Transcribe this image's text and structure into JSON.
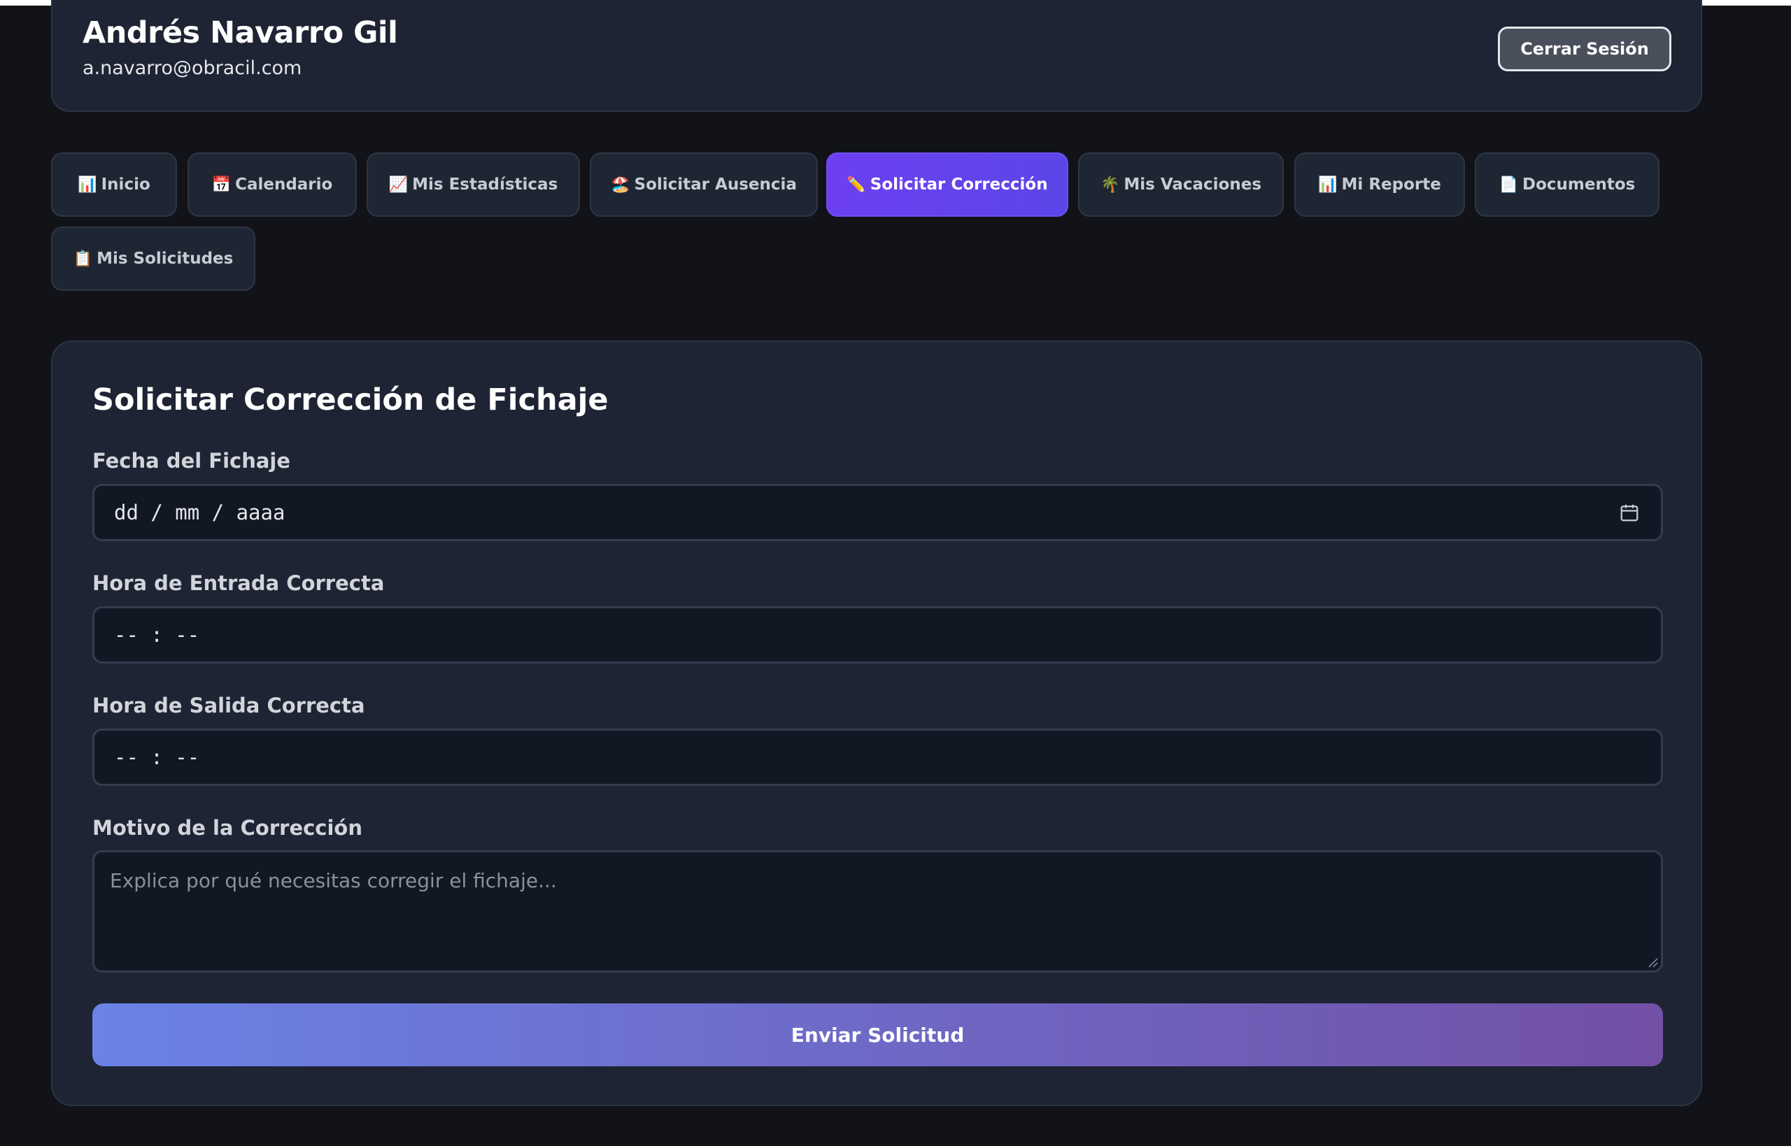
{
  "header": {
    "user_name": "Andrés Navarro Gil",
    "user_email": "a.navarro@obracil.com",
    "logout_label": "Cerrar Sesión"
  },
  "tabs": [
    {
      "icon": "📊",
      "label": "Inicio",
      "active": false
    },
    {
      "icon": "📅",
      "label": "Calendario",
      "active": false
    },
    {
      "icon": "📈",
      "label": "Mis Estadísticas",
      "active": false
    },
    {
      "icon": "🏖️",
      "label": "Solicitar Ausencia",
      "active": false
    },
    {
      "icon": "✏️",
      "label": "Solicitar Corrección",
      "active": true
    },
    {
      "icon": "🌴",
      "label": "Mis Vacaciones",
      "active": false
    },
    {
      "icon": "📊",
      "label": "Mi Reporte",
      "active": false
    },
    {
      "icon": "📄",
      "label": "Documentos",
      "active": false
    },
    {
      "icon": "📋",
      "label": "Mis Solicitudes",
      "active": false
    }
  ],
  "form": {
    "title": "Solicitar Corrección de Fichaje",
    "date_label": "Fecha del Fichaje",
    "date_placeholder": "dd / mm / aaaa",
    "entry_label": "Hora de Entrada Correcta",
    "entry_placeholder": "-- : --",
    "exit_label": "Hora de Salida Correcta",
    "exit_placeholder": "-- : --",
    "reason_label": "Motivo de la Corrección",
    "reason_placeholder": "Explica por qué necesitas corregir el fichaje...",
    "submit_label": "Enviar Solicitud"
  },
  "colors": {
    "accent": "#6d3ff0",
    "submit_gradient_start": "#6b82e6",
    "submit_gradient_end": "#7250a6"
  }
}
